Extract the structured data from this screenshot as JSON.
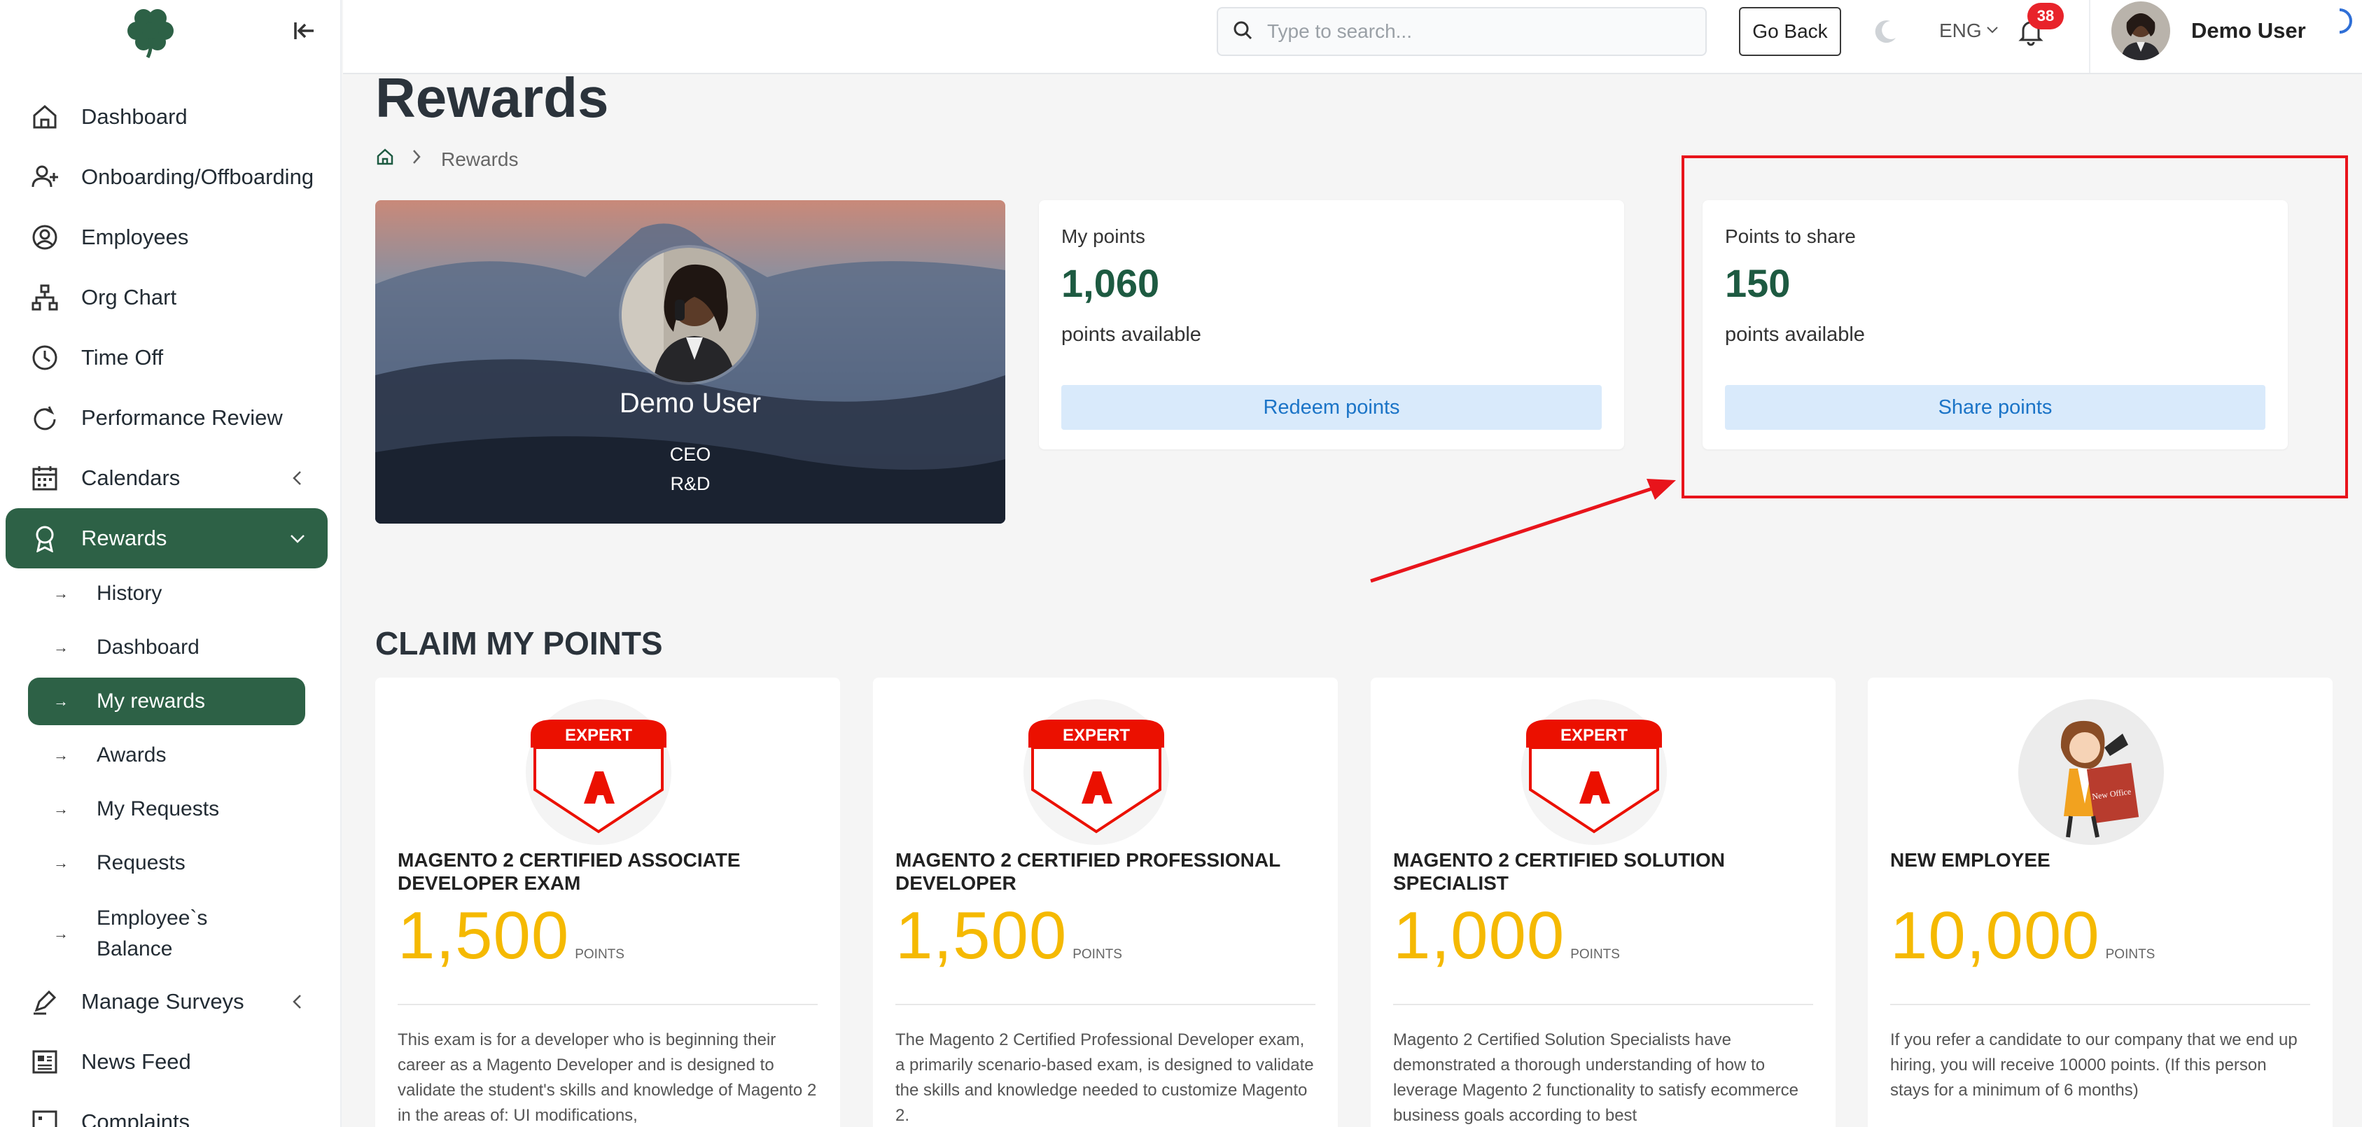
{
  "sidebar": {
    "items": [
      {
        "label": "Dashboard",
        "icon": "home-icon"
      },
      {
        "label": "Onboarding/Offboarding",
        "icon": "user-plus-icon"
      },
      {
        "label": "Employees",
        "icon": "user-circle-icon"
      },
      {
        "label": "Org Chart",
        "icon": "org-chart-icon"
      },
      {
        "label": "Time Off",
        "icon": "clock-icon"
      },
      {
        "label": "Performance Review",
        "icon": "refresh-icon"
      },
      {
        "label": "Calendars",
        "icon": "calendar-icon"
      },
      {
        "label": "Rewards",
        "icon": "award-icon"
      },
      {
        "label": "Manage Surveys",
        "icon": "pen-icon"
      },
      {
        "label": "News Feed",
        "icon": "newspaper-icon"
      },
      {
        "label": "Complaints",
        "icon": "chat-icon"
      }
    ],
    "rewards_sub": [
      {
        "label": "History"
      },
      {
        "label": "Dashboard"
      },
      {
        "label": "My rewards"
      },
      {
        "label": "Awards"
      },
      {
        "label": "My Requests"
      },
      {
        "label": "Requests"
      },
      {
        "label": "Employee`s Balance"
      }
    ]
  },
  "header": {
    "search_placeholder": "Type to search...",
    "go_back": "Go Back",
    "language": "ENG",
    "notifications": "38",
    "user_name": "Demo User"
  },
  "page": {
    "title": "Rewards",
    "breadcrumb": "Rewards"
  },
  "profile": {
    "name": "Demo User",
    "role": "CEO",
    "department": "R&D"
  },
  "my_points": {
    "label": "My points",
    "value": "1,060",
    "sub": "points available",
    "button": "Redeem points"
  },
  "share_points": {
    "label": "Points to share",
    "value": "150",
    "sub": "points available",
    "button": "Share points"
  },
  "claim": {
    "title": "CLAIM MY POINTS",
    "badge_text": "EXPERT",
    "unit": "POINTS",
    "cards": [
      {
        "title": "MAGENTO 2 CERTIFIED ASSOCIATE DEVELOPER EXAM",
        "points": "1,500",
        "desc": "This exam is for a developer who is beginning their career as a Magento Developer and is designed to validate the student's skills and knowledge of Magento 2 in the areas of: UI modifications,"
      },
      {
        "title": "MAGENTO 2 CERTIFIED PROFESSIONAL DEVELOPER",
        "points": "1,500",
        "desc": "The Magento 2 Certified Professional Developer exam, a primarily scenario-based exam, is designed to validate the skills and knowledge needed to customize Magento 2."
      },
      {
        "title": "MAGENTO 2 CERTIFIED SOLUTION SPECIALIST",
        "points": "1,000",
        "desc": "Magento 2 Certified Solution Specialists have demonstrated a thorough understanding of how to leverage Magento 2 functionality to satisfy ecommerce business goals according to best"
      },
      {
        "title": "NEW EMPLOYEE",
        "points": "10,000",
        "desc": "If you refer a candidate to our company that we end up hiring, you will receive 10000 points. (If this person stays for a minimum of 6 months)",
        "image_label": "New Office"
      }
    ]
  },
  "colors": {
    "brand_green": "#2d6146",
    "points_green": "#1d5a41",
    "points_yellow": "#f5b901",
    "annotation_red": "#e8141b",
    "button_bg": "#d9eafb",
    "button_text": "#1b74c7"
  }
}
